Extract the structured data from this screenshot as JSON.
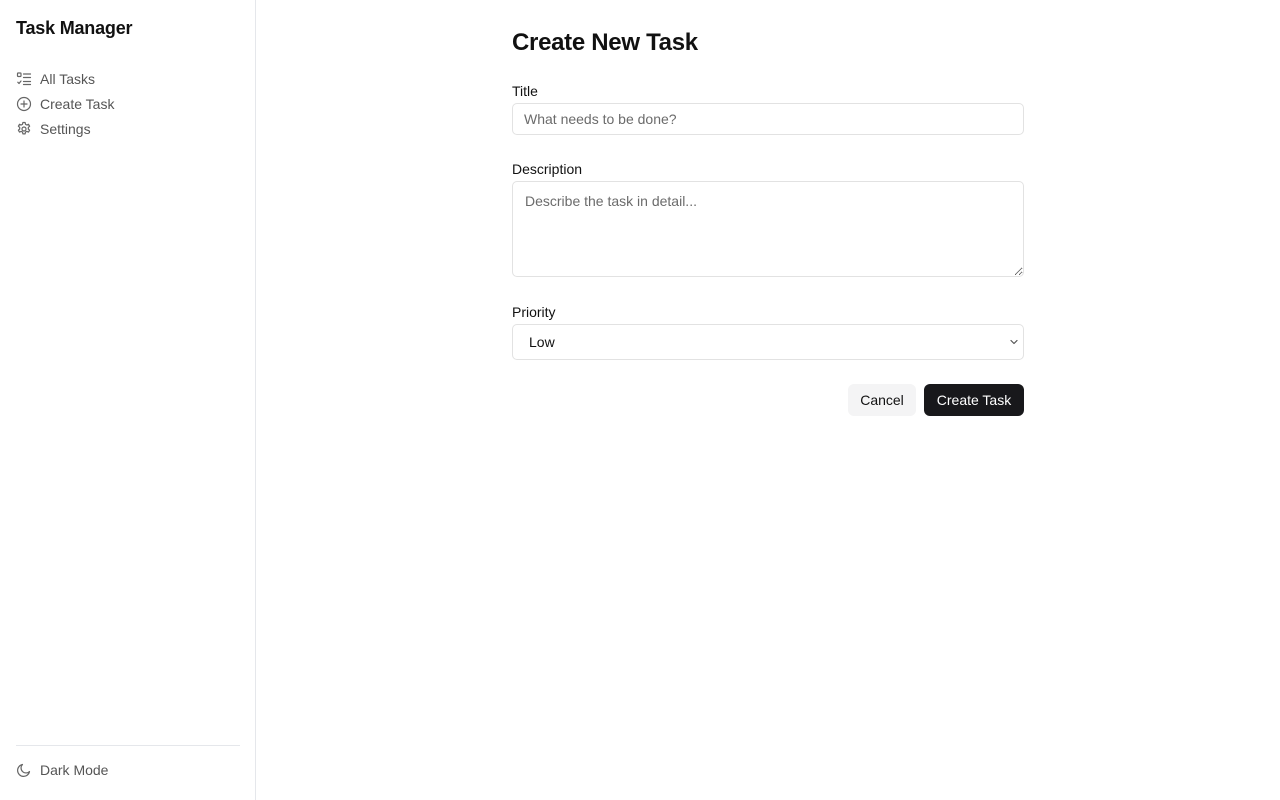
{
  "sidebar": {
    "app_title": "Task Manager",
    "nav": [
      {
        "label": "All Tasks",
        "icon": "list-checks-icon"
      },
      {
        "label": "Create Task",
        "icon": "plus-circle-icon"
      },
      {
        "label": "Settings",
        "icon": "gear-icon"
      }
    ],
    "dark_mode": {
      "label": "Dark Mode",
      "icon": "moon-icon"
    }
  },
  "form": {
    "page_title": "Create New Task",
    "title_field": {
      "label": "Title",
      "value": "",
      "placeholder": "What needs to be done?"
    },
    "description_field": {
      "label": "Description",
      "value": "",
      "placeholder": "Describe the task in detail..."
    },
    "priority_field": {
      "label": "Priority",
      "selected": "Low"
    },
    "cancel_label": "Cancel",
    "submit_label": "Create Task"
  },
  "colors": {
    "primary_button": "#18181b",
    "secondary_button": "#f4f4f5",
    "border": "#e2e2e2",
    "muted_text": "#555555"
  }
}
